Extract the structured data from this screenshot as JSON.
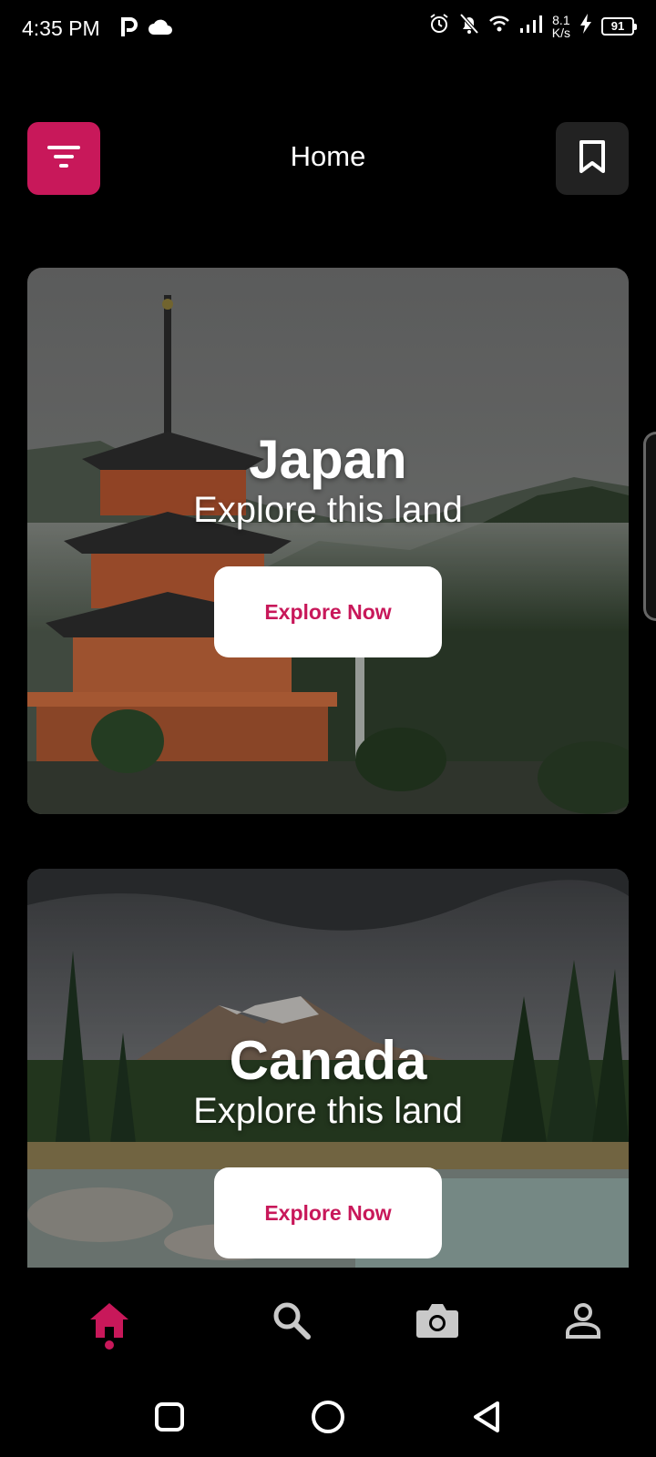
{
  "status_bar": {
    "time": "4:35 PM",
    "net_speed_value": "8.1",
    "net_speed_unit": "K/s",
    "battery": "91",
    "icons": [
      "p-icon",
      "cloud-icon",
      "alarm-icon",
      "bell-off-icon",
      "wifi-icon",
      "signal-icon",
      "charging-icon",
      "battery-icon"
    ]
  },
  "header": {
    "title": "Home",
    "left_button_icon": "filter-icon",
    "right_button_icon": "bookmark-icon"
  },
  "cards": [
    {
      "title": "Japan",
      "subtitle": "Explore this land",
      "button_label": "Explore Now"
    },
    {
      "title": "Canada",
      "subtitle": "Explore this land",
      "button_label": "Explore Now"
    }
  ],
  "bottom_nav": {
    "items": [
      "home-icon",
      "search-icon",
      "camera-icon",
      "profile-icon"
    ],
    "active": "home-icon"
  },
  "system_nav": [
    "recent-apps-icon",
    "home-circle-icon",
    "back-icon"
  ],
  "colors": {
    "accent": "#c8185a",
    "background": "#000000",
    "secondary_button": "#222222"
  }
}
